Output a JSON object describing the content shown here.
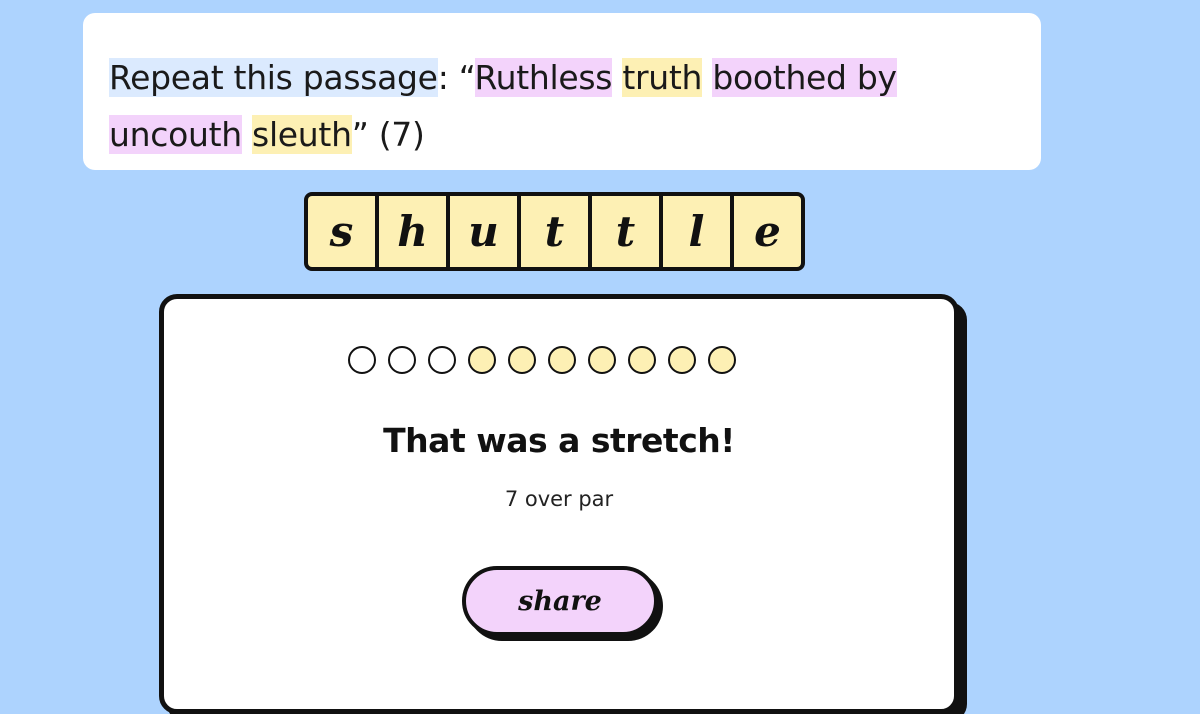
{
  "clue": {
    "definition": "Repeat this passage",
    "separator": ":",
    "open_quote": " “",
    "words": [
      {
        "text": "Ruthless",
        "highlight": "pink"
      },
      {
        "text": "truth",
        "highlight": "yellow"
      },
      {
        "text": "boothed by",
        "highlight": "pink"
      },
      {
        "text": "uncouth",
        "highlight": "pink"
      },
      {
        "text": "sleuth",
        "highlight": "yellow"
      }
    ],
    "close_quote": "”",
    "enumeration": "(7)"
  },
  "answer": {
    "letters": [
      "s",
      "h",
      "u",
      "t",
      "t",
      "l",
      "e"
    ]
  },
  "result": {
    "attempts": [
      {
        "state": "empty"
      },
      {
        "state": "empty"
      },
      {
        "state": "empty"
      },
      {
        "state": "filled"
      },
      {
        "state": "filled"
      },
      {
        "state": "filled"
      },
      {
        "state": "filled"
      },
      {
        "state": "filled"
      },
      {
        "state": "filled"
      },
      {
        "state": "filled"
      }
    ],
    "title": "That was a stretch!",
    "subtitle": "7 over par",
    "share_label": "share"
  },
  "colors": {
    "background": "#add3fe",
    "tile": "#fdf0b4",
    "highlight_pink": "#f3d3fb",
    "highlight_yellow": "#fdf0b4",
    "highlight_definition": "#dbeafe",
    "share_button": "#f3d3fb"
  }
}
